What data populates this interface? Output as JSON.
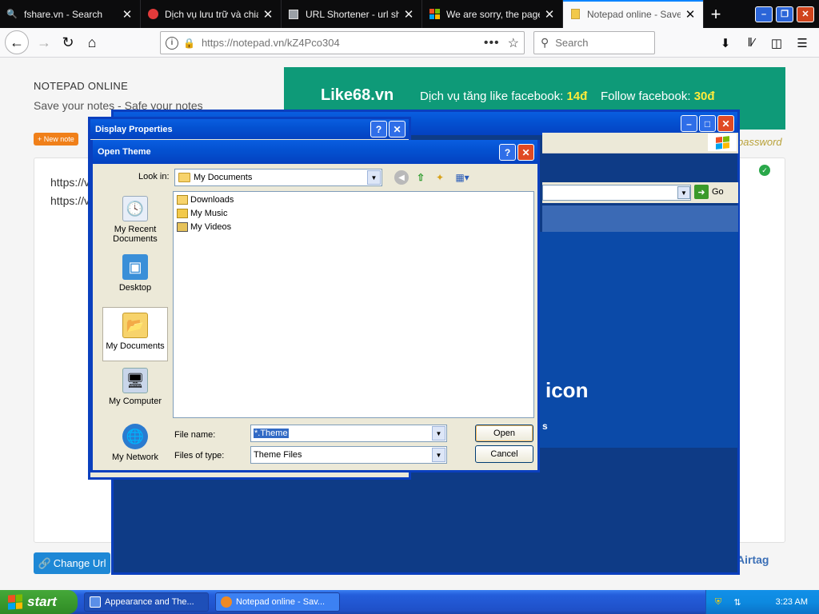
{
  "browser": {
    "tabs": [
      {
        "label": "fshare.vn - Search",
        "icon": "search-icon",
        "icon_color": "#4a90e2"
      },
      {
        "label": "Dịch vụ lưu trữ và chia s",
        "icon": "cloud-icon",
        "icon_color": "#e23b3b"
      },
      {
        "label": "URL Shortener - url shor",
        "icon": "link-icon",
        "icon_color": "#9aa0a6"
      },
      {
        "label": "We are sorry, the page y",
        "icon": "windows-logo-icon",
        "icon_color": "#00a4ef"
      },
      {
        "label": "Notepad online - Save n",
        "icon": "notepad-icon",
        "icon_color": "#f2c94a",
        "active": true
      }
    ],
    "new_tab_label": "+",
    "url": "https://notepad.vn/kZ4Pco304",
    "search_placeholder": "Search"
  },
  "page": {
    "site_title": "NOTEPAD ONLINE",
    "site_subtitle": "Save your notes - Safe your notes",
    "new_note_label": "+ New note",
    "note_lines": [
      "https://v",
      "https://v"
    ],
    "change_url_label": "Change Url",
    "airtag_label": "Airtag",
    "password_label": "password",
    "ad": {
      "brand": "Like68.vn",
      "text1": "Dịch vụ tăng like facebook: ",
      "price1": "14đ",
      "text2": "Follow facebook: ",
      "price2": "30đ"
    }
  },
  "bg_window": {
    "go_label": "Go",
    "icon_word": "icon",
    "s_char": "s"
  },
  "display_properties": {
    "title": "Display Properties"
  },
  "open_theme": {
    "title": "Open Theme",
    "look_in_label": "Look in:",
    "look_in_value": "My Documents",
    "places": [
      {
        "label": "My Recent Documents",
        "icon": "recent-documents-icon"
      },
      {
        "label": "Desktop",
        "icon": "desktop-icon"
      },
      {
        "label": "My Documents",
        "icon": "my-documents-icon",
        "selected": true
      },
      {
        "label": "My Computer",
        "icon": "my-computer-icon"
      },
      {
        "label": "My Network",
        "icon": "my-network-icon"
      }
    ],
    "files": [
      {
        "name": "Downloads",
        "icon": "folder-icon"
      },
      {
        "name": "My Music",
        "icon": "music-folder-icon"
      },
      {
        "name": "My Videos",
        "icon": "video-folder-icon"
      }
    ],
    "file_name_label": "File name:",
    "file_name_value": "*.Theme",
    "files_of_type_label": "Files of type:",
    "files_of_type_value": "Theme Files",
    "open_label": "Open",
    "cancel_label": "Cancel"
  },
  "taskbar": {
    "start_label": "start",
    "tasks": [
      {
        "label": "Appearance and The...",
        "active": true
      },
      {
        "label": "Notepad online - Sav..."
      }
    ],
    "clock": "3:23 AM"
  }
}
